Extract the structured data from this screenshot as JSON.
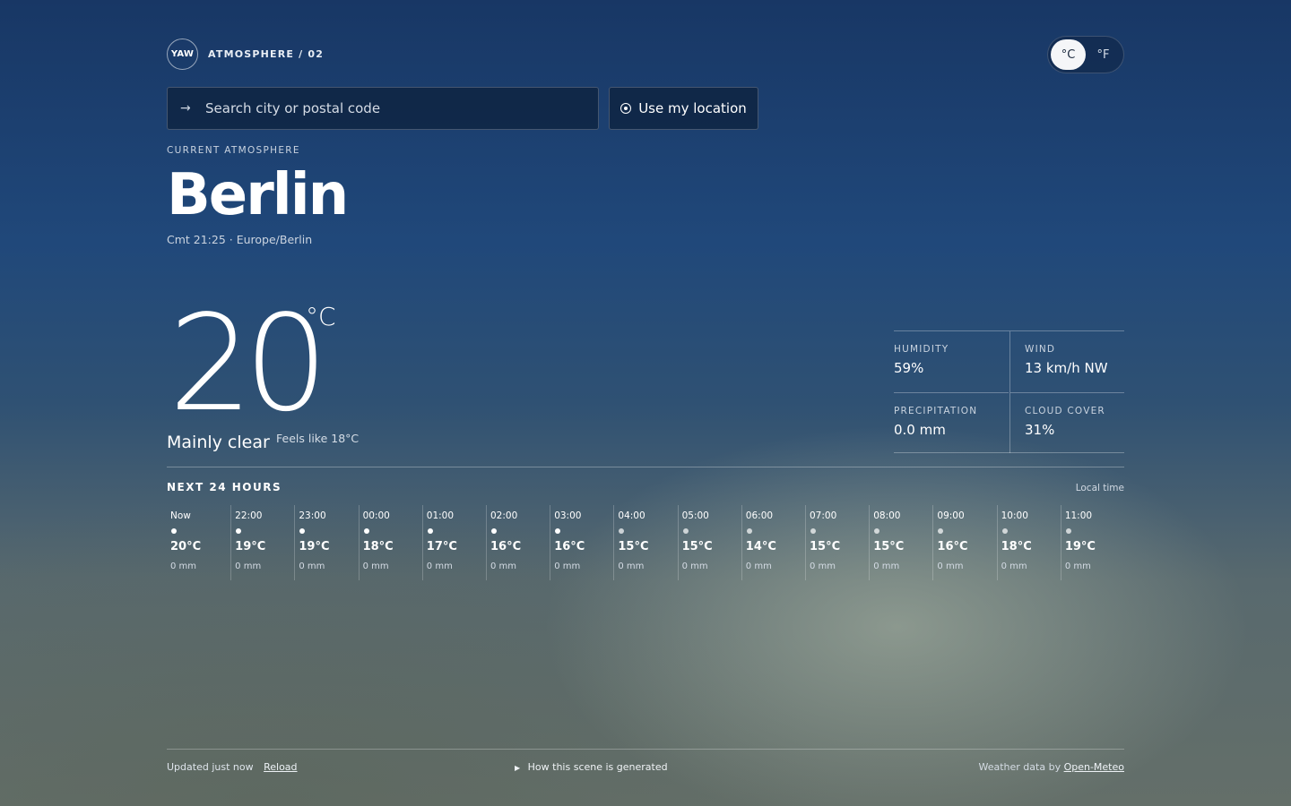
{
  "header": {
    "logo": "YAW",
    "brand": "ATMOSPHERE / 02",
    "units": {
      "celsius": "°C",
      "fahrenheit": "°F",
      "active": "celsius"
    }
  },
  "search": {
    "icon": "arrow-right-icon",
    "arrow": "→",
    "placeholder": "Search city or postal code",
    "value": "",
    "location_label": "Use my location",
    "location_icon": "target-icon"
  },
  "current": {
    "eyebrow": "CURRENT ATMOSPHERE",
    "city": "Berlin",
    "meta": "Cmt 21:25 · Europe/Berlin",
    "temperature": "20",
    "unit": "°C",
    "condition": "Mainly clear",
    "feels_like": "Feels like 18°C"
  },
  "stats": [
    {
      "label": "HUMIDITY",
      "value": "59%"
    },
    {
      "label": "WIND",
      "value": "13 km/h NW"
    },
    {
      "label": "PRECIPITATION",
      "value": "0.0 mm"
    },
    {
      "label": "CLOUD COVER",
      "value": "31%"
    }
  ],
  "hourly": {
    "title": "NEXT 24 HOURS",
    "note": "Local time",
    "items": [
      {
        "time": "Now",
        "temp": "20°C",
        "precip": "0 mm"
      },
      {
        "time": "22:00",
        "temp": "19°C",
        "precip": "0 mm"
      },
      {
        "time": "23:00",
        "temp": "19°C",
        "precip": "0 mm"
      },
      {
        "time": "00:00",
        "temp": "18°C",
        "precip": "0 mm"
      },
      {
        "time": "01:00",
        "temp": "17°C",
        "precip": "0 mm"
      },
      {
        "time": "02:00",
        "temp": "16°C",
        "precip": "0 mm"
      },
      {
        "time": "03:00",
        "temp": "16°C",
        "precip": "0 mm"
      },
      {
        "time": "04:00",
        "temp": "15°C",
        "precip": "0 mm"
      },
      {
        "time": "05:00",
        "temp": "15°C",
        "precip": "0 mm"
      },
      {
        "time": "06:00",
        "temp": "14°C",
        "precip": "0 mm"
      },
      {
        "time": "07:00",
        "temp": "15°C",
        "precip": "0 mm"
      },
      {
        "time": "08:00",
        "temp": "15°C",
        "precip": "0 mm"
      },
      {
        "time": "09:00",
        "temp": "16°C",
        "precip": "0 mm"
      },
      {
        "time": "10:00",
        "temp": "18°C",
        "precip": "0 mm"
      },
      {
        "time": "11:00",
        "temp": "19°C",
        "precip": "0 mm"
      }
    ]
  },
  "footer": {
    "updated": "Updated just now",
    "reload": "Reload",
    "how": "How this scene is generated",
    "credit_prefix": "Weather data by",
    "credit_link": "Open-Meteo"
  }
}
